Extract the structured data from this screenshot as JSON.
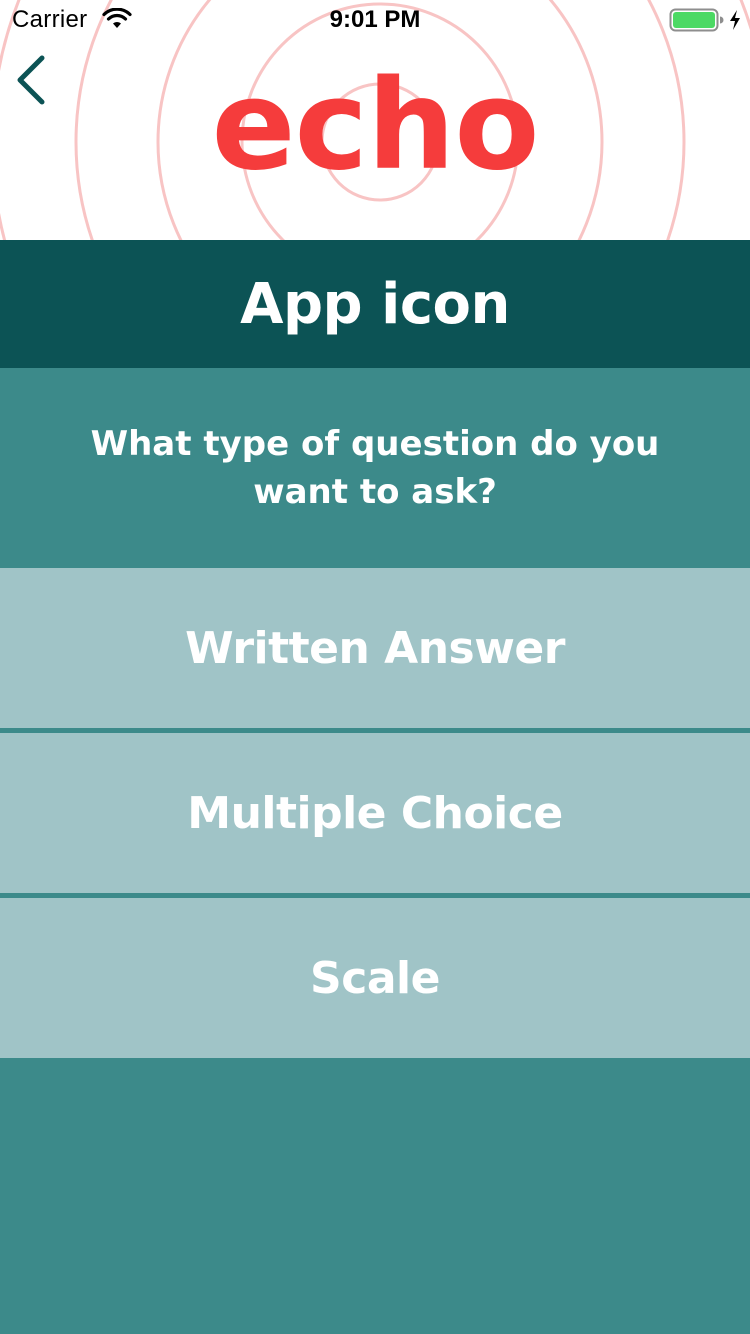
{
  "status_bar": {
    "carrier": "Carrier",
    "time": "9:01 PM",
    "battery_level": 1.0,
    "battery_color": "#4cd964",
    "icons": [
      "wifi-icon",
      "battery-icon",
      "charging-bolt-icon"
    ]
  },
  "header": {
    "logo_text": "echo",
    "logo_color": "#f53c3c",
    "ring_color": "#f8c4c4",
    "back_icon": "chevron-left-icon"
  },
  "title_bar": {
    "title": "App icon",
    "background": "#0c5355"
  },
  "prompt": {
    "text": "What type of question do you want to ask?",
    "background": "#3c8a8a"
  },
  "options": [
    {
      "label": "Written Answer"
    },
    {
      "label": "Multiple Choice"
    },
    {
      "label": "Scale"
    }
  ],
  "colors": {
    "option_background": "#a0c4c7",
    "page_background": "#3c8a8a",
    "text": "#ffffff"
  }
}
